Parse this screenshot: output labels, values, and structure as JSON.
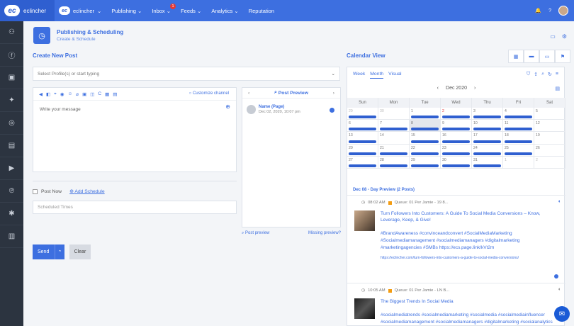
{
  "topbar": {
    "brand": "eclincher",
    "account": "eclincher",
    "nav": [
      {
        "label": "Publishing",
        "caret": true
      },
      {
        "label": "Inbox",
        "badge": "1",
        "caret": true
      },
      {
        "label": "Feeds",
        "caret": true
      },
      {
        "label": "Analytics",
        "caret": true
      },
      {
        "label": "Reputation",
        "caret": false
      }
    ]
  },
  "sidebar": {
    "icons": [
      "add-user-icon",
      "facebook-icon",
      "linkedin-icon",
      "twitter-icon",
      "instagram-icon",
      "store-icon",
      "youtube-icon",
      "pinterest-icon",
      "yelp-icon",
      "analytics-icon"
    ]
  },
  "header": {
    "title": "Publishing & Scheduling",
    "subtitle": "Create & Schedule"
  },
  "create": {
    "title": "Create New Post",
    "profile_placeholder": "Select Profile(s) or start typing",
    "customize": "Customize channel",
    "message_placeholder": "Write your message",
    "post_now": "Post Now",
    "add_schedule": "Add Schedule",
    "scheduled_placeholder": "Scheduled Times",
    "send": "Send",
    "clear": "Clear"
  },
  "preview": {
    "title": "Post Preview",
    "name": "Name (Page)",
    "date": "Dec 02, 2020, 10:07 pm",
    "post_preview_link": "Post preview",
    "missing_link": "Missing preview?"
  },
  "calendar": {
    "title": "Calendar View",
    "tabs": [
      "Week",
      "Month",
      "Visual"
    ],
    "active_tab": "Month",
    "month": "Dec 2020",
    "days": [
      "Sun",
      "Mon",
      "Tue",
      "Wed",
      "Thu",
      "Fri",
      "Sat"
    ],
    "weeks": [
      [
        "29",
        "30",
        "1",
        "2",
        "3",
        "4",
        "5"
      ],
      [
        "6",
        "7",
        "8",
        "9",
        "10",
        "11",
        "12"
      ],
      [
        "13",
        "14",
        "15",
        "16",
        "17",
        "18",
        "19"
      ],
      [
        "20",
        "21",
        "22",
        "23",
        "24",
        "25",
        "26"
      ],
      [
        "27",
        "28",
        "29",
        "30",
        "31",
        "1",
        "2"
      ]
    ],
    "day_preview": "Dec 08 - Day Preview (2 Posts)",
    "posts": [
      {
        "time": "08:02 AM",
        "queue": "Queue: 01 Per Jamie - 19 8...",
        "title": "Turn Followers Into Customers: A Guide To Social Media Conversions – Know, Leverage, Keep, & Give!",
        "tags": "#BrandAwareness #convinceandconvert #SocialMediaMarketing #Socialmediamanagement #socialmediamanagers #digitalmarketing #marketingagencies #SMBs https://ecs.page.link/kVt2m",
        "link": "https://eclincher.com/turn-followers-into-customers-a-guide-to-social-media-conversions/"
      },
      {
        "time": "10:05 AM",
        "queue": "Queue: 01 Per Jamie - LN B...",
        "title": "The Biggest Trends In Social Media",
        "tags": "#socialmediatrends #socialmediamarketing #socialmedia #socialmediainfluencer #socialmediamanagement #socialmediamanagers #digitalmarketing #socialanalytics"
      }
    ]
  },
  "colors": {
    "accent": "#3d6fe0",
    "sidebar": "#2c3440",
    "badge": "#e53935"
  }
}
